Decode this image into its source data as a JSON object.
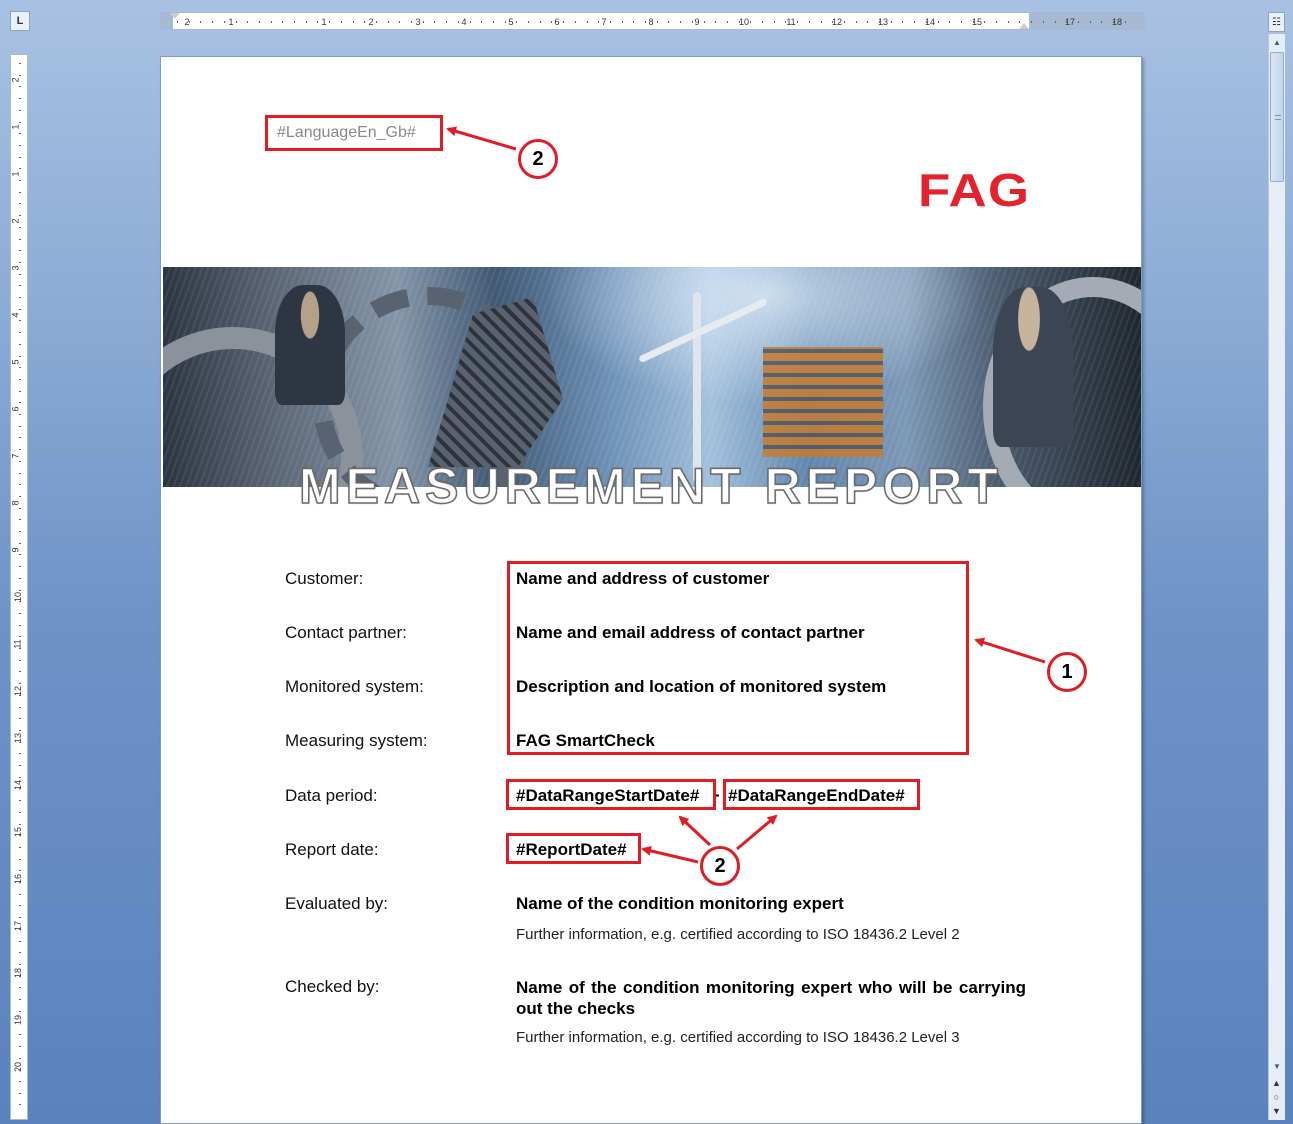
{
  "ruler": {
    "corner": "L",
    "h_ticks": [
      "2",
      "1",
      "1",
      "2",
      "3",
      "4",
      "5",
      "6",
      "7",
      "8",
      "9",
      "10",
      "11",
      "12",
      "13",
      "14",
      "15",
      "17",
      "18"
    ],
    "v_ticks": [
      "2",
      "1",
      "1",
      "2",
      "3",
      "4",
      "5",
      "6",
      "7",
      "8",
      "9",
      "10",
      "11",
      "12",
      "13",
      "14",
      "15",
      "16",
      "17",
      "18",
      "19",
      "20"
    ]
  },
  "document": {
    "language_placeholder": "#LanguageEn_Gb#",
    "logo": "FAG",
    "title": "MEASUREMENT REPORT",
    "fields": [
      {
        "label": "Customer:",
        "value": "Name and address of customer"
      },
      {
        "label": "Contact partner:",
        "value": "Name and email address of contact partner"
      },
      {
        "label": "Monitored system:",
        "value": "Description and location of monitored system"
      },
      {
        "label": "Measuring system:",
        "value": "FAG SmartCheck"
      }
    ],
    "data_period": {
      "label": "Data period:",
      "start": "#DataRangeStartDate#",
      "separator": "-",
      "end": "#DataRangeEndDate#"
    },
    "report_date": {
      "label": "Report date:",
      "value": "#ReportDate#"
    },
    "evaluated_by": {
      "label": "Evaluated by:",
      "value": "Name of the condition monitoring expert",
      "info": "Further information,  e.g. certified according to ISO 18436.2 Level 2"
    },
    "checked_by": {
      "label": "Checked by:",
      "value": "Name  of  the  condition  monitoring  expert  who  will  be carrying out the checks",
      "info": "Further information,  e.g. certified according to ISO 18436.2 Level 3"
    }
  },
  "annotations": {
    "callout_1": "1",
    "callout_2a": "2",
    "callout_2b": "2",
    "color": "#e01c24"
  },
  "icons": {
    "scroll_up": "scroll-up-arrow-icon",
    "scroll_down": "scroll-down-arrow-icon",
    "view_ruler": "view-ruler-icon",
    "prev_page": "previous-page-icon",
    "select_browse": "select-browse-object-icon",
    "next_page": "next-page-icon"
  }
}
